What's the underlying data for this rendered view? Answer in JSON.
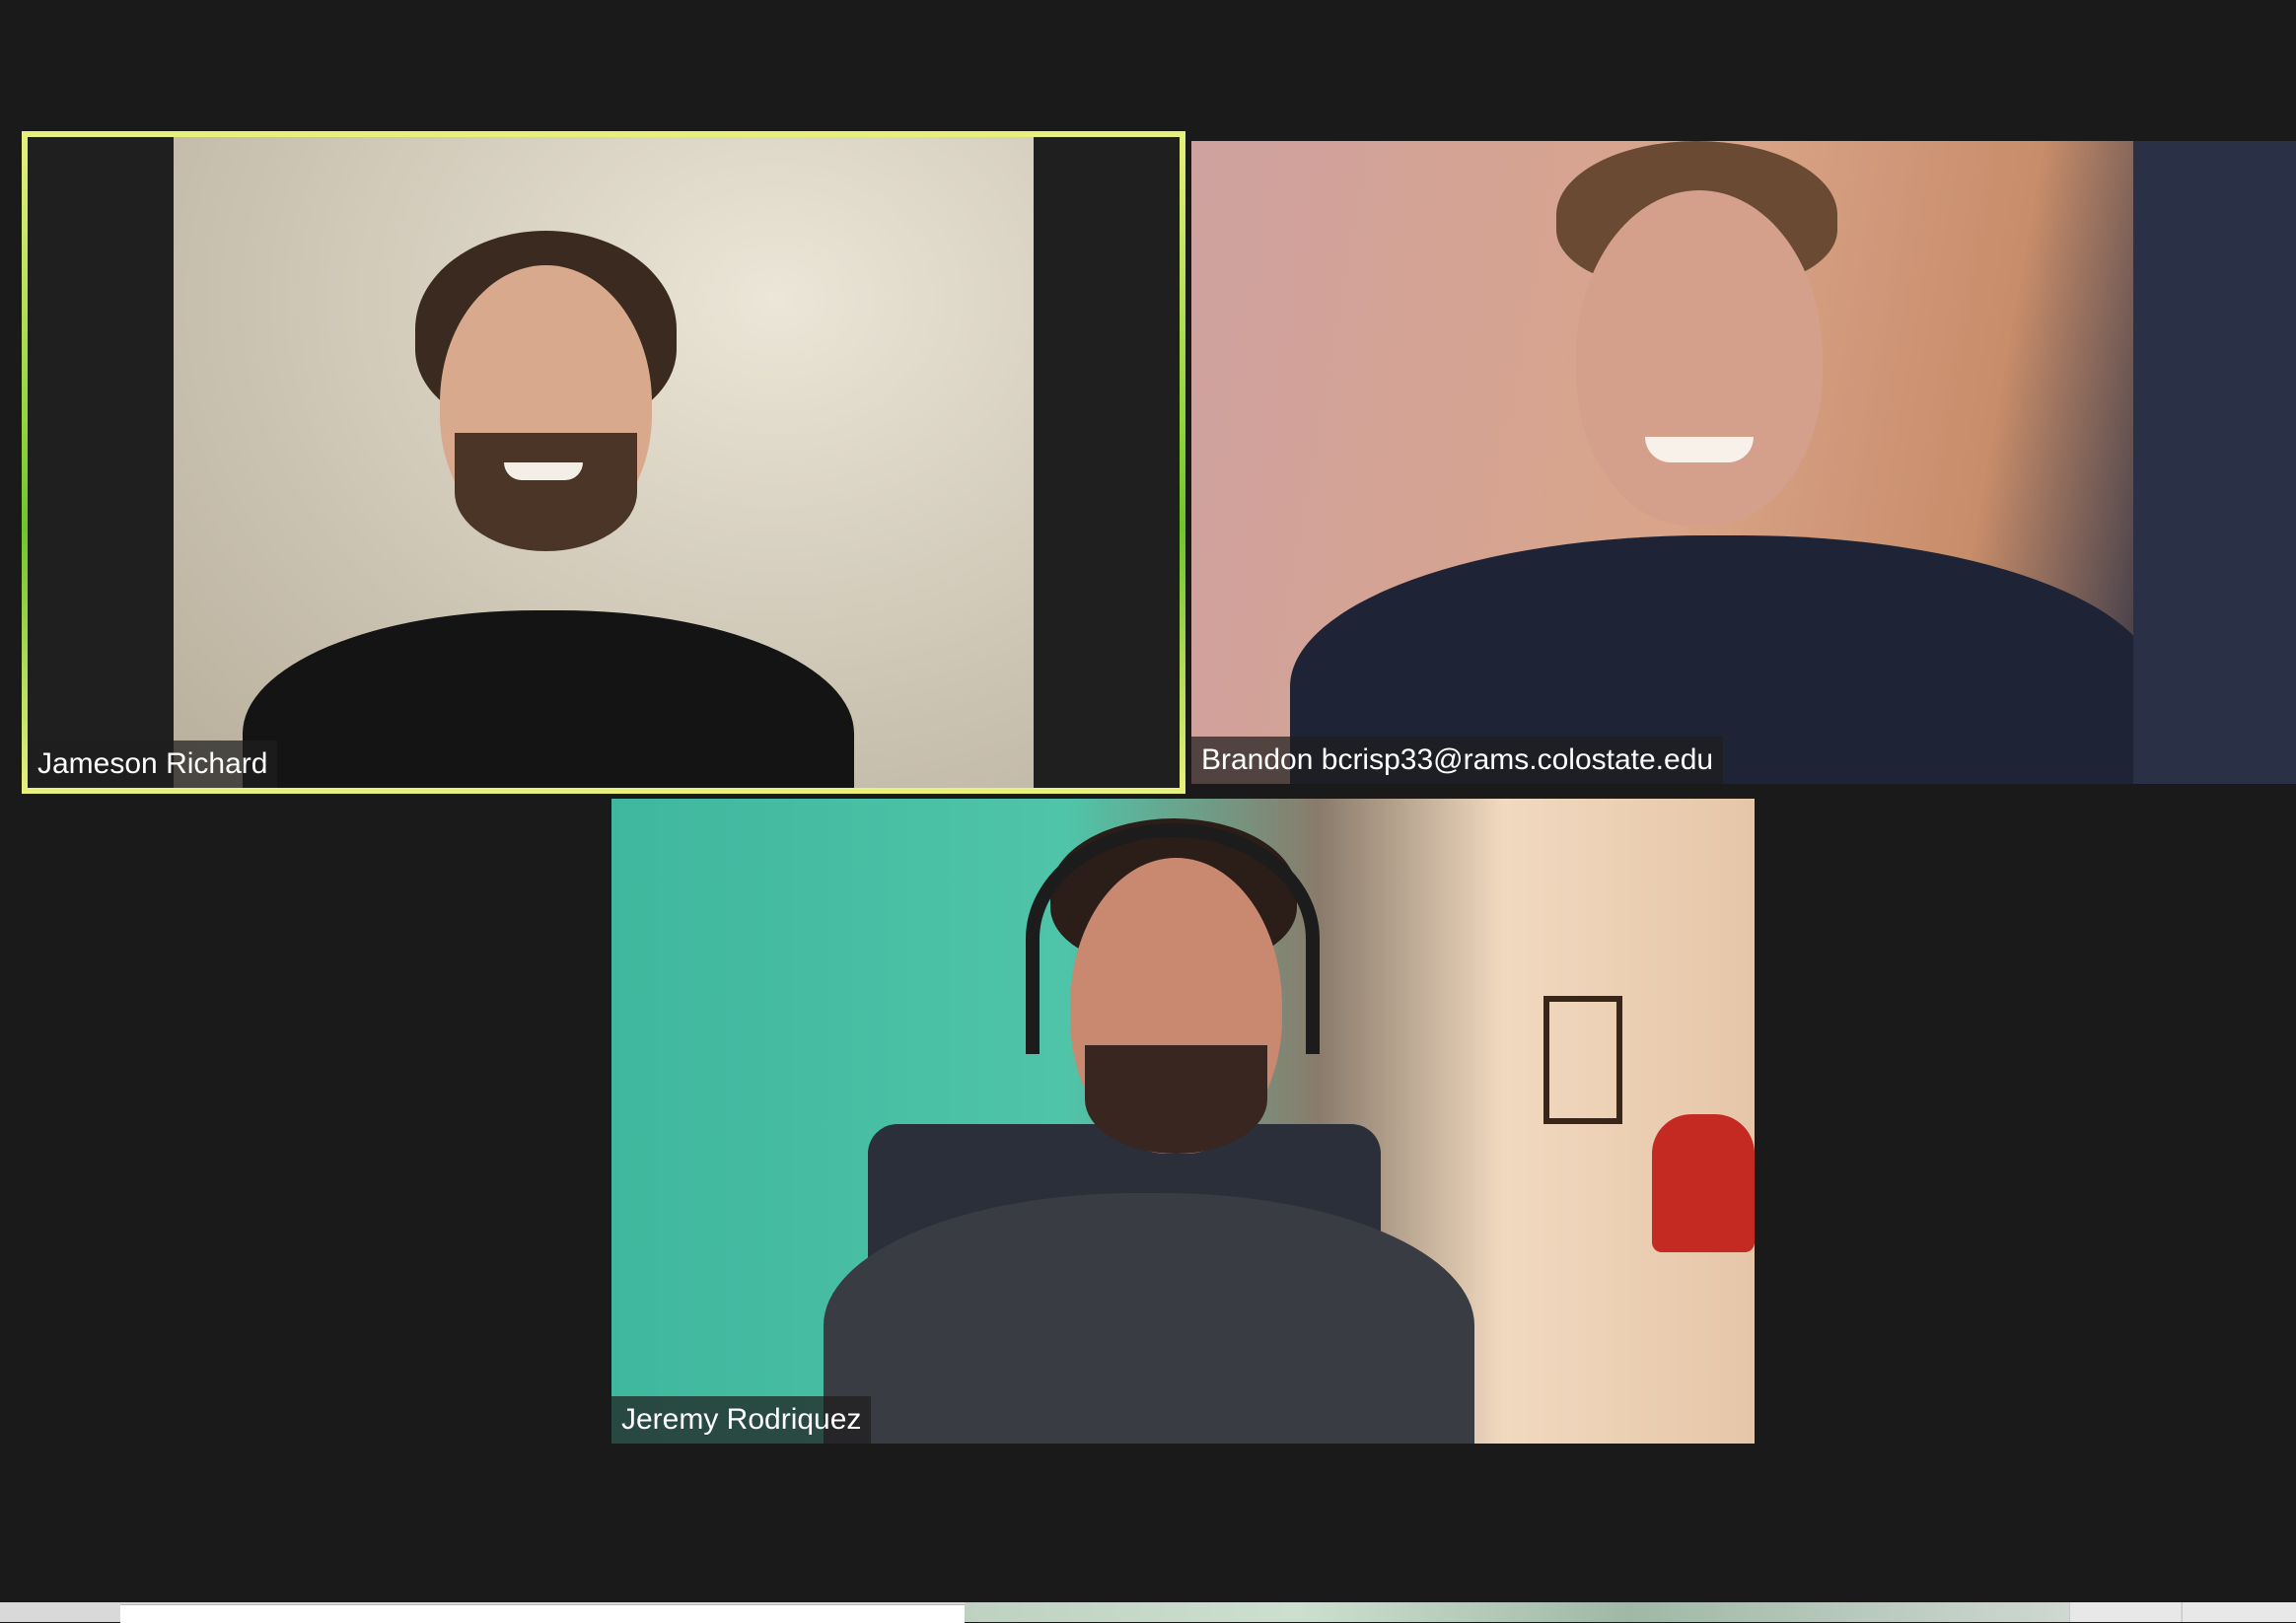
{
  "meeting": {
    "participants": [
      {
        "name": "Jameson Richard",
        "active_speaker": true
      },
      {
        "name": "Brandon bcrisp33@rams.colostate.edu",
        "active_speaker": false
      },
      {
        "name": "Jeremy Rodriquez",
        "active_speaker": false
      }
    ],
    "active_speaker_color": "#b9e35a",
    "background_color": "#1a1a1a"
  },
  "taskbar": {
    "search_placeholder": ""
  }
}
